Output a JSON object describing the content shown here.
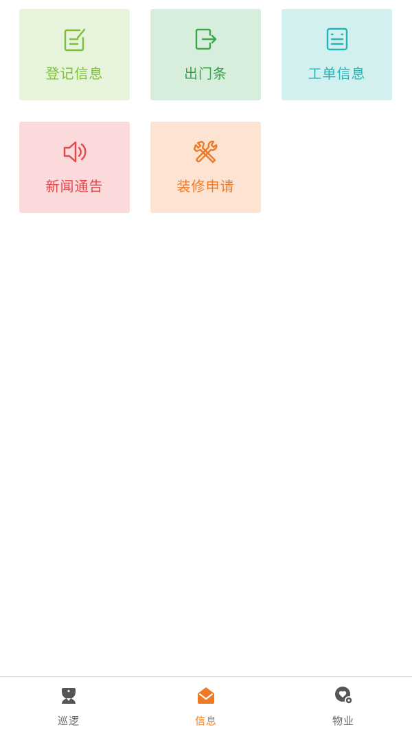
{
  "tiles": [
    {
      "label": "登记信息",
      "icon": "edit-note-icon",
      "color": "#7bbf3b",
      "bg": "#e7f4db"
    },
    {
      "label": "出门条",
      "icon": "exit-icon",
      "color": "#3aa54b",
      "bg": "#d6eedb"
    },
    {
      "label": "工单信息",
      "icon": "form-icon",
      "color": "#25b4b4",
      "bg": "#d1f0ef"
    },
    {
      "label": "新闻通告",
      "icon": "speaker-icon",
      "color": "#e0474c",
      "bg": "#fadadb"
    },
    {
      "label": "装修申请",
      "icon": "tools-icon",
      "color": "#ef7a26",
      "bg": "#fde3d2"
    }
  ],
  "tabbar": {
    "active_color": "#ef7a26",
    "inactive_color": "#666666",
    "items": [
      {
        "label": "巡逻",
        "icon": "guard-icon",
        "active": false
      },
      {
        "label": "信息",
        "icon": "mail-icon",
        "active": true
      },
      {
        "label": "物业",
        "icon": "property-settings-icon",
        "active": false
      }
    ]
  }
}
